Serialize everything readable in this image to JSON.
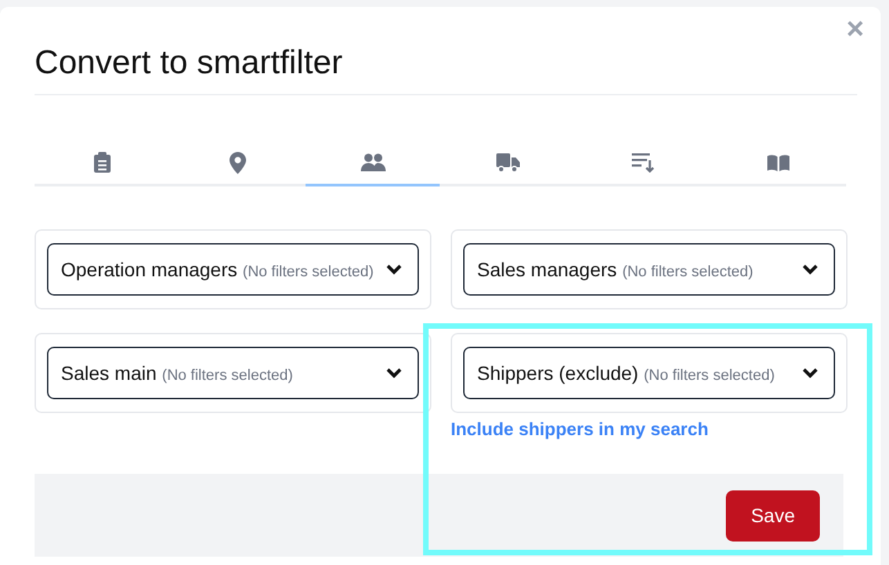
{
  "dialog": {
    "title": "Convert to smartfilter",
    "close": "×"
  },
  "tabs": [
    {
      "kind": "clipboard",
      "selected": false
    },
    {
      "kind": "pin",
      "selected": false
    },
    {
      "kind": "people",
      "selected": true
    },
    {
      "kind": "truck",
      "selected": false
    },
    {
      "kind": "sort",
      "selected": false
    },
    {
      "kind": "book",
      "selected": false
    }
  ],
  "filters": [
    {
      "label": "Operation managers",
      "hint": "(No filters selected)",
      "highlighted": false
    },
    {
      "label": "Sales managers",
      "hint": "(No filters selected)",
      "highlighted": false
    },
    {
      "label": "Sales main",
      "hint": "(No filters selected)",
      "highlighted": false
    },
    {
      "label": "Shippers (exclude)",
      "hint": "(No filters selected)",
      "highlighted": true,
      "link": "Include shippers in my search"
    }
  ],
  "buttons": [
    {
      "label": "Save"
    }
  ]
}
